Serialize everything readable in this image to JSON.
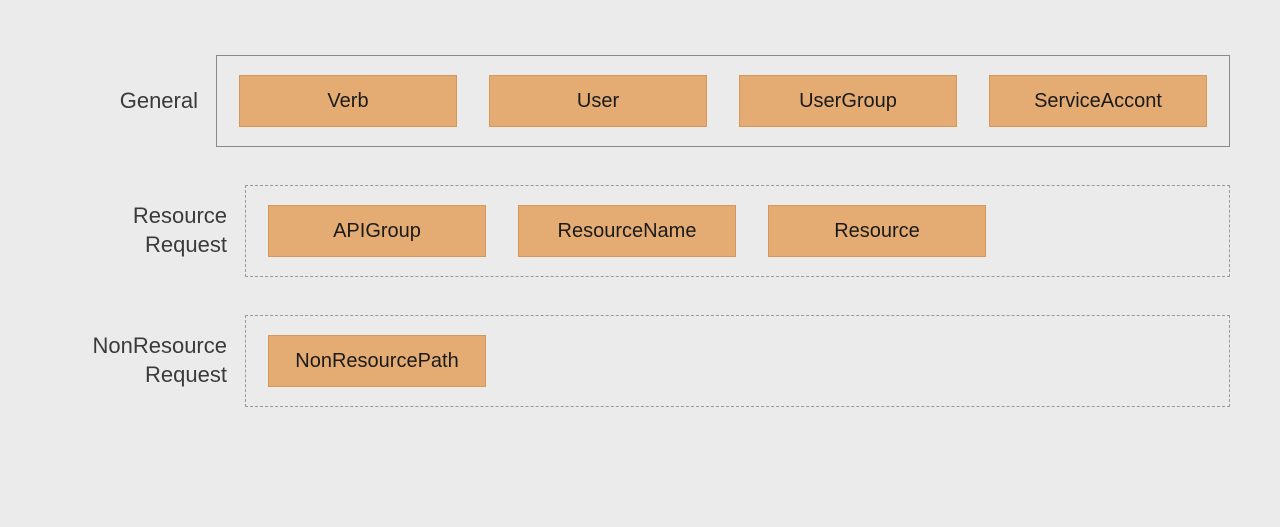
{
  "rows": [
    {
      "label": "General",
      "multiline": false,
      "style": "solid",
      "chips": [
        "Verb",
        "User",
        "UserGroup",
        "ServiceAccont"
      ]
    },
    {
      "label": "Resource Request",
      "multiline": true,
      "style": "dashed",
      "chips": [
        "APIGroup",
        "ResourceName",
        "Resource"
      ]
    },
    {
      "label": "NonResource Request",
      "multiline": true,
      "style": "dashed",
      "chips": [
        "NonResourcePath"
      ]
    }
  ],
  "colors": {
    "chipFill": "#e4ac73",
    "chipBorder": "#d59858",
    "background": "#ebebeb"
  }
}
